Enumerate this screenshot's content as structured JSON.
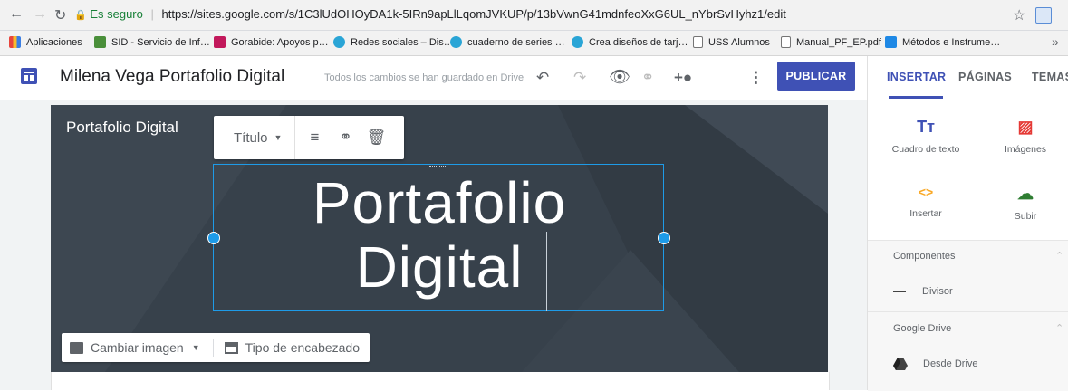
{
  "browser": {
    "secure_label": "Es seguro",
    "url": "https://sites.google.com/s/1C3lUdOHOyDA1k-5IRn9apLlLqomJVKUP/p/13bVwnG41mdnfeoXxG6UL_nYbrSvHyhz1/edit",
    "bookmarks": [
      {
        "label": "Aplicaciones",
        "icon": "apps-grid-icon",
        "color": "#e8453c"
      },
      {
        "label": "SID - Servicio de Inf…",
        "icon": "sid-favicon",
        "color": "#4a8f3a"
      },
      {
        "label": "Gorabide: Apoyos p…",
        "icon": "gorabide-favicon",
        "color": "#c2185b"
      },
      {
        "label": "Redes sociales – Dis…",
        "icon": "circle-favicon",
        "color": "#2aa5d6"
      },
      {
        "label": "cuaderno de series …",
        "icon": "circle-favicon",
        "color": "#2aa5d6"
      },
      {
        "label": "Crea diseños de tarj…",
        "icon": "circle-favicon",
        "color": "#2aa5d6"
      },
      {
        "label": "USS Alumnos",
        "icon": "page-icon",
        "color": "#757575"
      },
      {
        "label": "Manual_PF_EP.pdf",
        "icon": "page-icon",
        "color": "#757575"
      },
      {
        "label": "Métodos e Instrume…",
        "icon": "sites-favicon",
        "color": "#1e88e5"
      }
    ],
    "overflow": "»"
  },
  "header": {
    "title": "Milena Vega Portafolio Digital",
    "save_status": "Todos los cambios se han guardado en Drive",
    "publish_label": "PUBLICAR"
  },
  "canvas": {
    "site_name": "Portafolio Digital",
    "toolbar_style": "Título",
    "title_line1": "Portafolio",
    "title_line2": "Digital",
    "change_image_label": "Cambiar imagen",
    "header_type_label": "Tipo de encabezado"
  },
  "panel": {
    "tabs": [
      "INSERTAR",
      "PÁGINAS",
      "TEMAS"
    ],
    "tiles": [
      {
        "label": "Cuadro de texto",
        "icon": "text-box-icon",
        "glyph": "Tт",
        "color": "#3f51b5"
      },
      {
        "label": "Imágenes",
        "icon": "image-icon",
        "glyph": "▨",
        "color": "#e53935"
      },
      {
        "label": "Insertar",
        "icon": "embed-icon",
        "glyph": "<>",
        "color": "#f9a825"
      },
      {
        "label": "Subir",
        "icon": "upload-cloud-icon",
        "glyph": "☁",
        "color": "#2e7d32"
      }
    ],
    "components_title": "Componentes",
    "divider_label": "Divisor",
    "drive_title": "Google Drive",
    "from_drive_label": "Desde Drive"
  },
  "colors": {
    "accent": "#3f51b5",
    "selection": "#1e9be8",
    "banner": "#37414b"
  }
}
